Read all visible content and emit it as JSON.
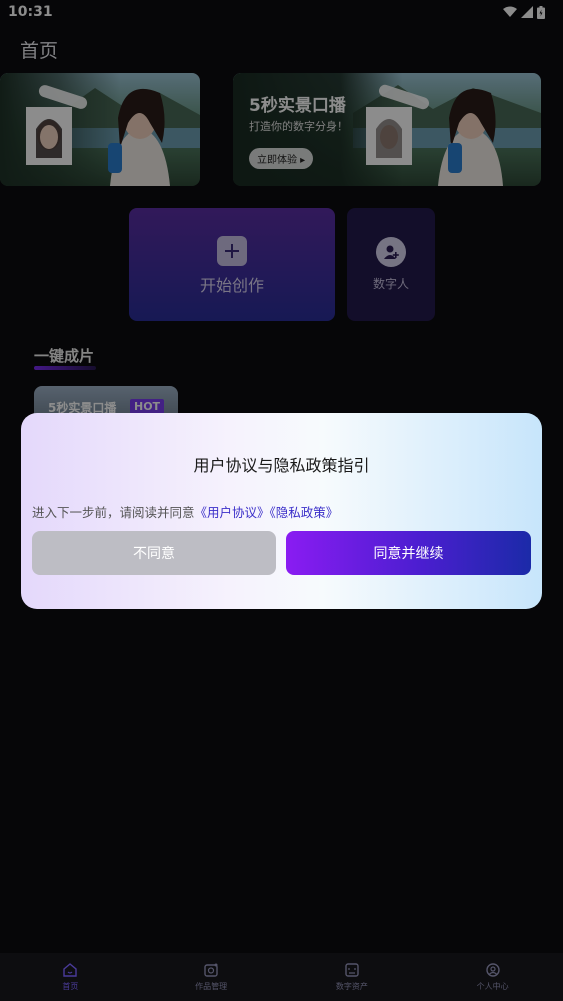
{
  "status_bar": {
    "time": "10:31"
  },
  "header": {
    "title": "首页"
  },
  "banners": {
    "right": {
      "title": "5秒实景口播",
      "subtitle": "打造你的数字分身！",
      "button": "立即体验 ▸"
    }
  },
  "actions": {
    "create_label": "开始创作",
    "digital_human_label": "数字人"
  },
  "section": {
    "title": "一键成片",
    "card_title": "5秒实景口播",
    "hot_badge": "HOT"
  },
  "dialog": {
    "title": "用户协议与隐私政策指引",
    "body_prefix": "进入下一步前，请阅读并同意",
    "user_agreement_link": "《用户协议》",
    "privacy_link": "《隐私政策》",
    "disagree_button": "不同意",
    "agree_button": "同意并继续"
  },
  "bottom_nav": {
    "items": [
      {
        "label": "首页",
        "icon": "home-icon",
        "active": true
      },
      {
        "label": "作品管理",
        "icon": "works-icon",
        "active": false
      },
      {
        "label": "数字资产",
        "icon": "assets-icon",
        "active": false
      },
      {
        "label": "个人中心",
        "icon": "profile-icon",
        "active": false
      }
    ]
  },
  "colors": {
    "accent_purple": "#7b2cf5",
    "link": "#3b2fc9",
    "disagree_bg": "#bdbdc4"
  }
}
